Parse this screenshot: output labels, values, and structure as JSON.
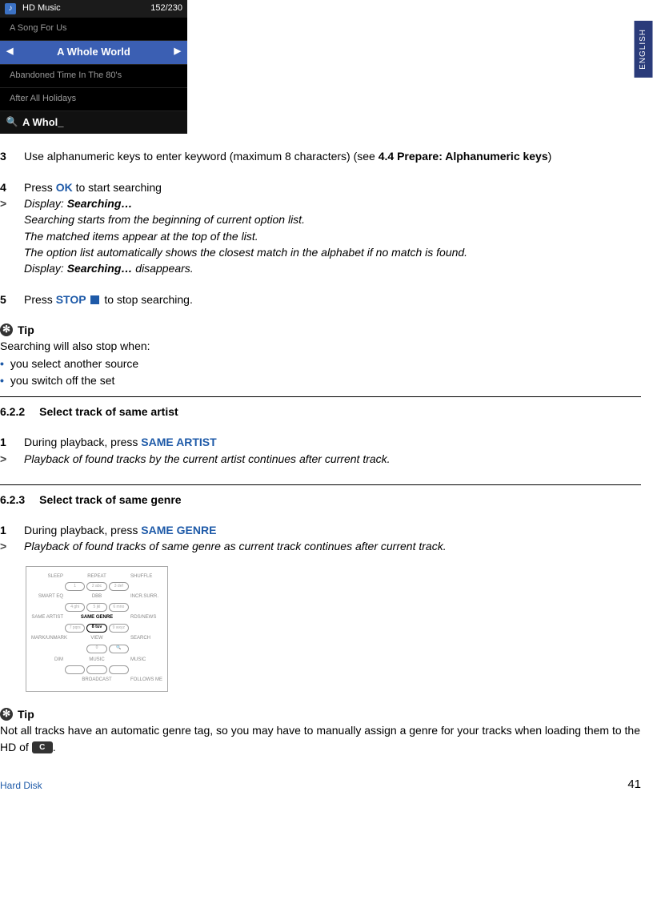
{
  "lang_tab": "ENGLISH",
  "device_screen": {
    "header_label": "HD Music",
    "header_count": "152/230",
    "rows": [
      "A Song For Us",
      "A Whole World",
      "Abandoned Time In The 80's",
      "After All Holidays"
    ],
    "selected_index": 1,
    "search_text": "A Whol_"
  },
  "step3": {
    "num": "3",
    "pre": "Use alphanumeric keys to enter keyword (maximum 8 characters) (see ",
    "ref": "4.4 Prepare: Alphanumeric keys",
    "post": ")"
  },
  "step4": {
    "num": "4",
    "pre": "Press ",
    "btn": "OK",
    "post": " to start searching"
  },
  "step4_result": {
    "marker": ">",
    "display_label": "Display: ",
    "display_value": "Searching…",
    "line2": "Searching starts from the beginning of current option list.",
    "line3": "The matched items appear at the top of the list.",
    "line4": "The option list automatically shows the closest match in the alphabet if no match is found.",
    "line5_pre": "Display: ",
    "line5_val": "Searching…",
    "line5_post": " disappears."
  },
  "step5": {
    "num": "5",
    "pre": "Press ",
    "btn": "STOP",
    "post": " to stop searching."
  },
  "tip1": {
    "label": "Tip",
    "intro": "Searching will also stop when:",
    "items": [
      "you select another source",
      "you switch off the set"
    ]
  },
  "sec622": {
    "num": "6.2.2",
    "title": "Select track of same artist",
    "step1_num": "1",
    "step1_pre": "During playback, press ",
    "step1_btn": "SAME ARTIST",
    "result_marker": ">",
    "result": "Playback of found tracks by the current artist continues after current track."
  },
  "sec623": {
    "num": "6.2.3",
    "title": "Select track of same genre",
    "step1_num": "1",
    "step1_pre": "During playback, press ",
    "step1_btn": "SAME GENRE",
    "result_marker": ">",
    "result": "Playback of found tracks of same genre as current track continues after current track."
  },
  "remote": {
    "rows": [
      {
        "left": "SLEEP",
        "center": "REPEAT",
        "right": "SHUFFLE",
        "b1": "1",
        "b2": "2 abc",
        "b3": "3 def"
      },
      {
        "left": "SMART EQ",
        "center": "DBB",
        "right": "INCR.SURR.",
        "b1": "4 ghi",
        "b2": "5 jkl",
        "b3": "6 mno"
      },
      {
        "left": "SAME ARTIST",
        "center": "SAME GENRE",
        "right": "RDS/NEWS",
        "b1": "7 pqrs",
        "b2": "8 tuv",
        "b3": "9 wxyz",
        "highlight": "b2"
      },
      {
        "left": "MARK/UNMARK",
        "center": "VIEW",
        "right": "SEARCH",
        "b1": "",
        "b2": "0",
        "b3": "🔍"
      },
      {
        "left": "DIM",
        "center": "",
        "right": "",
        "b1": "",
        "b2": "",
        "b3": "",
        "sub_c": "MUSIC",
        "sub_r": "MUSIC",
        "sub2_c": "BROADCAST",
        "sub2_r": "FOLLOWS ME"
      }
    ]
  },
  "tip2": {
    "label": "Tip",
    "text_pre": "Not all tracks have an automatic genre tag, so you may have to manually assign a genre for your tracks when loading them to the HD of ",
    "badge": "C",
    "text_post": "."
  },
  "footer": {
    "section": "Hard Disk",
    "page": "41"
  }
}
